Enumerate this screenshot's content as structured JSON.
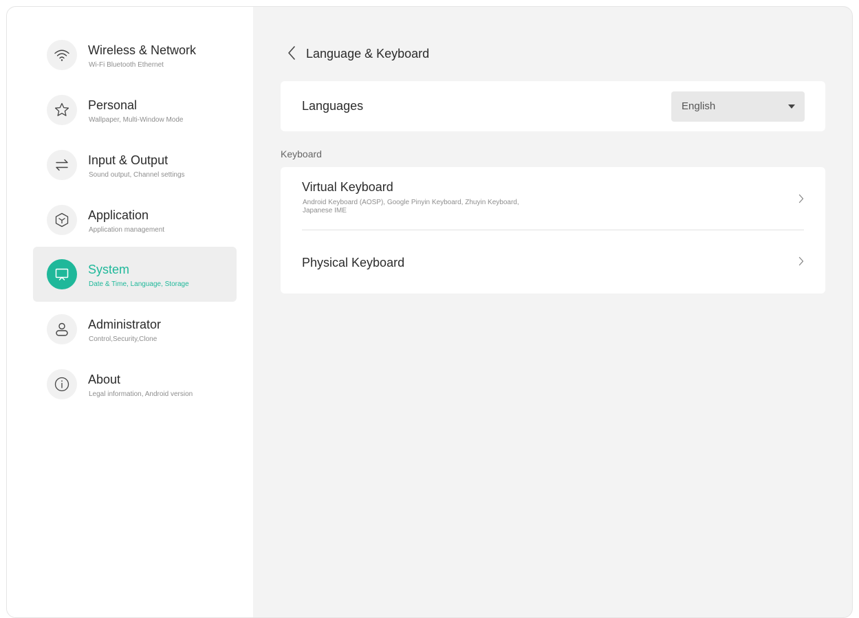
{
  "colors": {
    "accent": "#1fb89a",
    "sidebar_bg": "#ffffff",
    "content_bg": "#f3f3f3",
    "selected_bg": "#eeeeee"
  },
  "sidebar": {
    "items": [
      {
        "title": "Wireless & Network",
        "subtitle": "Wi-Fi Bluetooth Ethernet",
        "icon": "wifi-icon",
        "selected": false
      },
      {
        "title": "Personal",
        "subtitle": "Wallpaper, Multi-Window Mode",
        "icon": "star-icon",
        "selected": false
      },
      {
        "title": "Input & Output",
        "subtitle": "Sound output, Channel settings",
        "icon": "swap-arrows-icon",
        "selected": false
      },
      {
        "title": "Application",
        "subtitle": "Application management",
        "icon": "cube-icon",
        "selected": false
      },
      {
        "title": "System",
        "subtitle": "Date & Time, Language, Storage",
        "icon": "monitor-icon",
        "selected": true
      },
      {
        "title": "Administrator",
        "subtitle": "Control,Security,Clone",
        "icon": "person-icon",
        "selected": false
      },
      {
        "title": "About",
        "subtitle": "Legal information, Android version",
        "icon": "info-icon",
        "selected": false
      }
    ]
  },
  "main": {
    "title": "Language & Keyboard",
    "languages": {
      "label": "Languages",
      "selected": "English"
    },
    "keyboard_section": {
      "label": "Keyboard",
      "items": [
        {
          "title": "Virtual Keyboard",
          "subtitle": "Android Keyboard (AOSP), Google Pinyin Keyboard, Zhuyin Keyboard, Japanese IME"
        },
        {
          "title": "Physical Keyboard"
        }
      ]
    }
  }
}
